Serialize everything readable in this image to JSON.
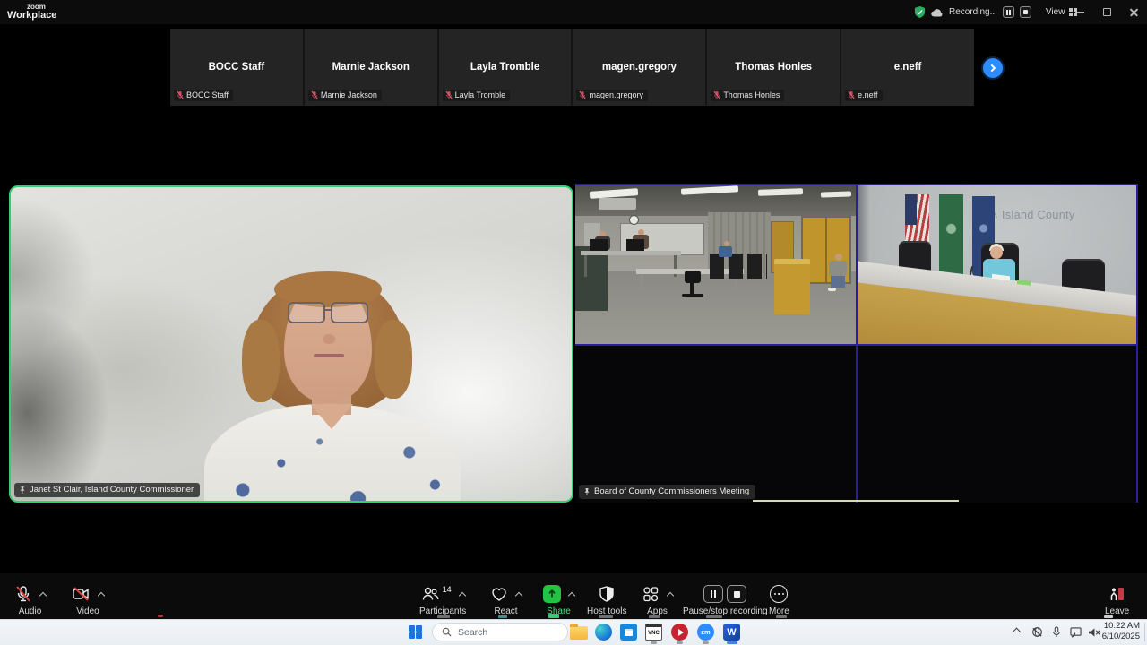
{
  "window": {
    "brand_top": "zoom",
    "brand_bottom": "Workplace",
    "recording_status": "Recording...",
    "view_label": "View"
  },
  "filmstrip": {
    "participants": [
      {
        "name": "BOCC Staff"
      },
      {
        "name": "Marnie Jackson"
      },
      {
        "name": "Layla Tromble"
      },
      {
        "name": "magen.gregory"
      },
      {
        "name": "Thomas Honles"
      },
      {
        "name": "e.neff"
      }
    ]
  },
  "main_video": {
    "speaker_label": "Janet St Clair, Island County Commissioner"
  },
  "grid": {
    "meeting_label": "Board of County Commissioners Meeting",
    "room_wall_text": "Island County"
  },
  "toolbar": {
    "audio_label": "Audio",
    "video_label": "Video",
    "participants_label": "Participants",
    "participants_count": "14",
    "react_label": "React",
    "share_label": "Share",
    "host_tools_label": "Host tools",
    "apps_label": "Apps",
    "recording_control_label": "Pause/stop recording",
    "more_label": "More",
    "leave_label": "Leave"
  },
  "taskbar": {
    "search_placeholder": "Search",
    "vnc_label": "VNC",
    "zoom_app_label": "zm",
    "word_label": "W",
    "time": "10:22 AM",
    "date": "6/10/2025"
  },
  "icons": {
    "recording_shield": "green shield with white check",
    "cloud": "cloud recording",
    "muted_mic": "red microphone with slash",
    "muted_camera": "red camera with slash",
    "pin": "pinned video pin",
    "next_arrow": "blue circle right chevron"
  },
  "colors": {
    "zoom_blue": "#2D8CFF",
    "active_speaker_green": "#35CF70",
    "share_green": "#23C343",
    "grid_border_purple": "#2A1D9E",
    "record_red": "#D6453F",
    "leave_red": "#C23A48"
  }
}
